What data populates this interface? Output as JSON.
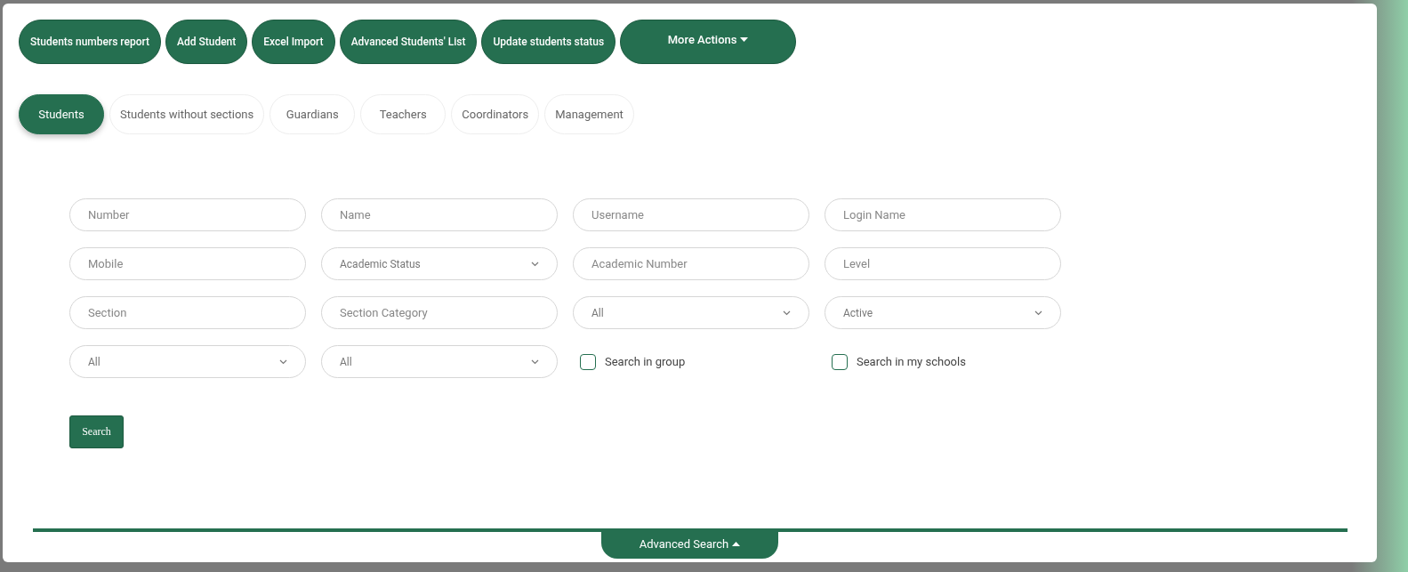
{
  "actions": [
    {
      "label": "Students numbers report"
    },
    {
      "label": "Add Student"
    },
    {
      "label": "Excel Import"
    },
    {
      "label": "Advanced Students' List"
    },
    {
      "label": "Update students status"
    },
    {
      "label": "More Actions",
      "dropdown": true
    }
  ],
  "tabs": [
    {
      "label": "Students",
      "selected": true
    },
    {
      "label": "Students without sections",
      "selected": false
    },
    {
      "label": "Guardians",
      "selected": false
    },
    {
      "label": "Teachers",
      "selected": false
    },
    {
      "label": "Coordinators",
      "selected": false
    },
    {
      "label": "Management",
      "selected": false
    }
  ],
  "filters": [
    {
      "kind": "text",
      "placeholder": "Number"
    },
    {
      "kind": "text",
      "placeholder": "Name"
    },
    {
      "kind": "text",
      "placeholder": "Username"
    },
    {
      "kind": "text",
      "placeholder": "Login Name"
    },
    {
      "kind": "text",
      "placeholder": "Mobile"
    },
    {
      "kind": "select",
      "value": "Academic Status"
    },
    {
      "kind": "text",
      "placeholder": "Academic Number"
    },
    {
      "kind": "text",
      "placeholder": "Level"
    },
    {
      "kind": "text",
      "placeholder": "Section"
    },
    {
      "kind": "text",
      "placeholder": "Section Category"
    },
    {
      "kind": "select",
      "value": "All"
    },
    {
      "kind": "select",
      "value": "Active"
    },
    {
      "kind": "select",
      "value": "All"
    },
    {
      "kind": "select",
      "value": "All"
    },
    {
      "kind": "checkbox",
      "label": "Search in group",
      "checked": false
    },
    {
      "kind": "checkbox",
      "label": "Search in my schools",
      "checked": false
    }
  ],
  "search_button": "Search",
  "advanced_search": {
    "label": "Advanced Search",
    "expanded": true
  }
}
